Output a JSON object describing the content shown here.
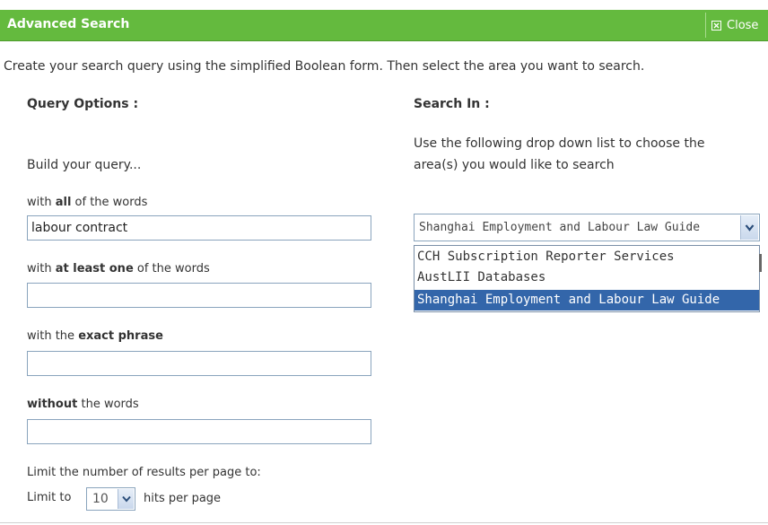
{
  "dialog": {
    "title": "Advanced Search",
    "close_label": "Close",
    "intro": "Create your search query using the simplified Boolean form. Then select the area you want to search."
  },
  "query_options": {
    "heading": "Query Options :",
    "build_label": "Build your query...",
    "all_words": {
      "prefix": "with ",
      "bold": "all",
      "suffix": " of the words",
      "value": "labour contract"
    },
    "at_least_one": {
      "prefix": "with ",
      "bold": "at least one",
      "suffix": " of the words",
      "value": ""
    },
    "exact_phrase": {
      "prefix": "with the ",
      "bold": "exact phrase",
      "suffix": "",
      "value": ""
    },
    "without": {
      "prefix": "",
      "bold": "without",
      "suffix": " the words",
      "value": ""
    },
    "limit_heading": "Limit the number of results per page to:",
    "limit_prefix": "Limit to",
    "limit_value": "10",
    "limit_suffix": "hits per page"
  },
  "search_in": {
    "heading": "Search In :",
    "instruction_line1": "Use the following drop down list to choose the",
    "instruction_line2": "area(s) you would like to search",
    "selected_value": "Shanghai Employment and Labour Law Guide",
    "options": [
      "CCH Subscription Reporter Services",
      "AustLII Databases",
      "Shanghai Employment and Labour Law Guide"
    ],
    "highlighted_index": 2
  },
  "colors": {
    "titlebar": "#64ba3e",
    "selection": "#3366aa"
  },
  "icons": {
    "close": "close-box-icon",
    "dropdown": "chevron-down-icon"
  }
}
